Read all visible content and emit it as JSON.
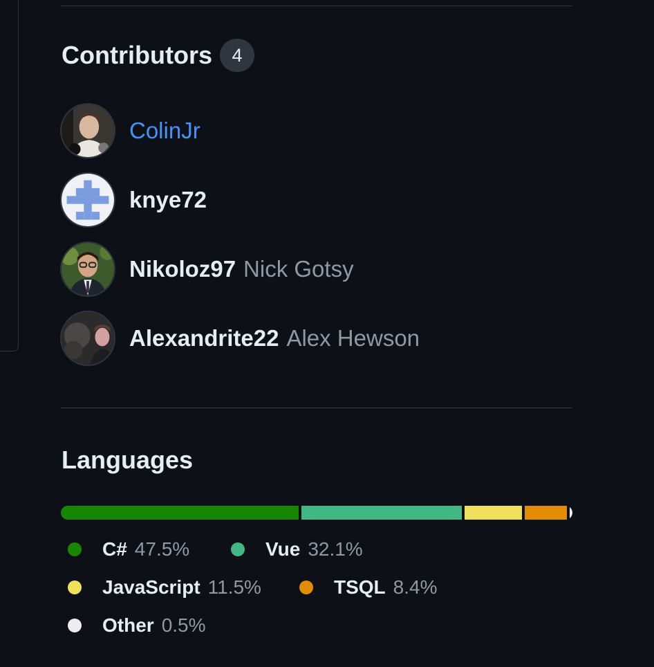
{
  "contributors": {
    "title": "Contributors",
    "count": "4",
    "items": [
      {
        "login": "ColinJr",
        "name": "",
        "avatar": "avatar-colinjr"
      },
      {
        "login": "knye72",
        "name": "",
        "avatar": "avatar-identicon"
      },
      {
        "login": "Nikoloz97",
        "name": "Nick Gotsy",
        "avatar": "avatar-nikoloz97"
      },
      {
        "login": "Alexandrite22",
        "name": "Alex Hewson",
        "avatar": "avatar-alexandrite22"
      }
    ]
  },
  "languages": {
    "title": "Languages",
    "items": [
      {
        "name": "C#",
        "percent": "47.5%",
        "value": 47.5,
        "color": "#178600"
      },
      {
        "name": "Vue",
        "percent": "32.1%",
        "value": 32.1,
        "color": "#41b883"
      },
      {
        "name": "JavaScript",
        "percent": "11.5%",
        "value": 11.5,
        "color": "#f1e05a"
      },
      {
        "name": "TSQL",
        "percent": "8.4%",
        "value": 8.4,
        "color": "#e38c00"
      },
      {
        "name": "Other",
        "percent": "0.5%",
        "value": 0.5,
        "color": "#ededed"
      }
    ]
  },
  "colors": {
    "background": "#0d1117",
    "link": "#4493f8",
    "muted": "#9198a1",
    "border": "#30363d"
  }
}
